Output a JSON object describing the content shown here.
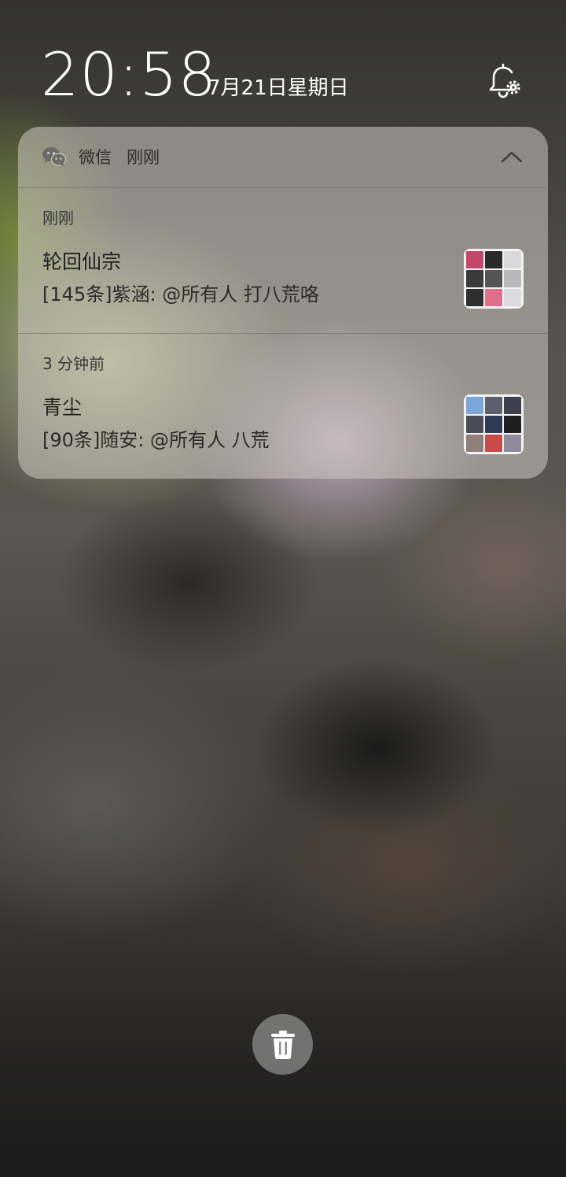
{
  "lockscreen": {
    "time": "20:58",
    "date": "7月21日星期日",
    "notification_settings_icon": "bell-settings-icon"
  },
  "notification_group": {
    "app_icon": "wechat-icon",
    "app_name": "微信",
    "time": "刚刚",
    "collapse_icon": "chevron-up-icon",
    "messages": [
      {
        "time": "刚刚",
        "title": "轮回仙宗",
        "text": "[145条]紫涵: @所有人 打八荒咯",
        "avatar": "group-avatar-grid"
      },
      {
        "time": "3 分钟前",
        "title": "青尘",
        "text": "[90条]随安: @所有人 八荒",
        "avatar": "group-avatar-grid"
      }
    ]
  },
  "clear_button": {
    "icon": "trash-icon"
  },
  "colors": {
    "card_background": "#cdc8c3",
    "text_primary": "#1f1f1f",
    "clear_button": "#8c8c8c"
  }
}
